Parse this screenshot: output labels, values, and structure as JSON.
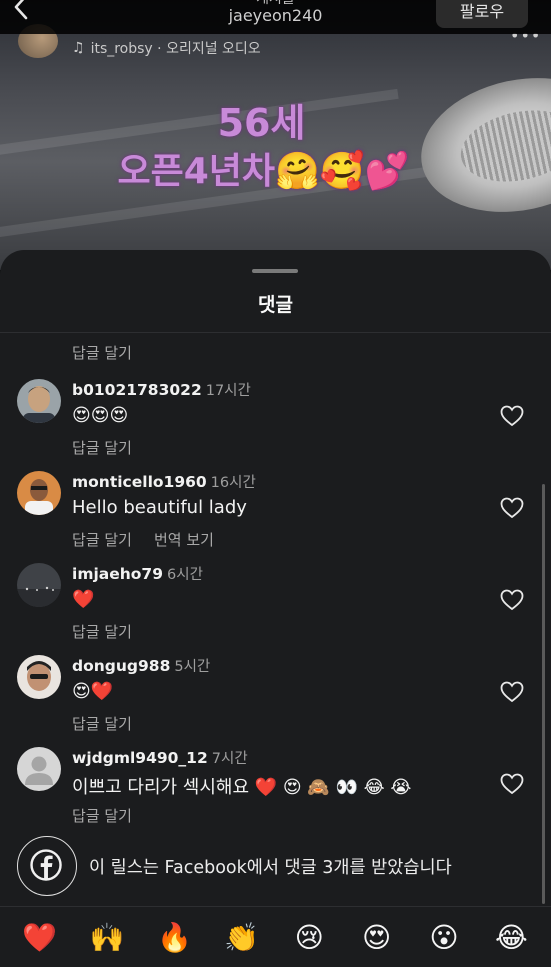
{
  "header": {
    "title_partial": "게시물",
    "username": "jaeyeon240",
    "follow_label": "팔로우",
    "audio_label": "its_robsy · 오리지널 오디오"
  },
  "reel_overlay": {
    "line1": "56세",
    "line2": "오픈4년차🤗🥰💕"
  },
  "sheet": {
    "title": "댓글",
    "top_reply_label": "답글 달기"
  },
  "comments": [
    {
      "username": "b01021783022",
      "time": "17시간",
      "text": "😍😍😍",
      "reply": "답글 달기",
      "translate": ""
    },
    {
      "username": "monticello1960",
      "time": "16시간",
      "text": "Hello beautiful lady",
      "reply": "답글 달기",
      "translate": "번역 보기"
    },
    {
      "username": "imjaeho79",
      "time": "6시간",
      "text": "❤️",
      "reply": "답글 달기",
      "translate": ""
    },
    {
      "username": "dongug988",
      "time": "5시간",
      "text": "😍❤️",
      "reply": "답글 달기",
      "translate": ""
    },
    {
      "username": "wjdgml9490_12",
      "time": "7시간",
      "text": "이쁘고 다리가 섹시해요 ❤️ 😍 🙈 👀 😂 😭",
      "reply": "답글 달기",
      "translate": ""
    }
  ],
  "facebook_notice": "이 릴스는 Facebook에서 댓글 3개를 받았습니다",
  "emoji_bar": [
    "❤️",
    "🙌",
    "🔥",
    "👏",
    "😢",
    "😍",
    "😮",
    "😂"
  ],
  "colors": {
    "sheet_bg": "#1b1c1e",
    "secondary_text": "#a8a8a8",
    "overlay_text": "#c88ad8"
  }
}
